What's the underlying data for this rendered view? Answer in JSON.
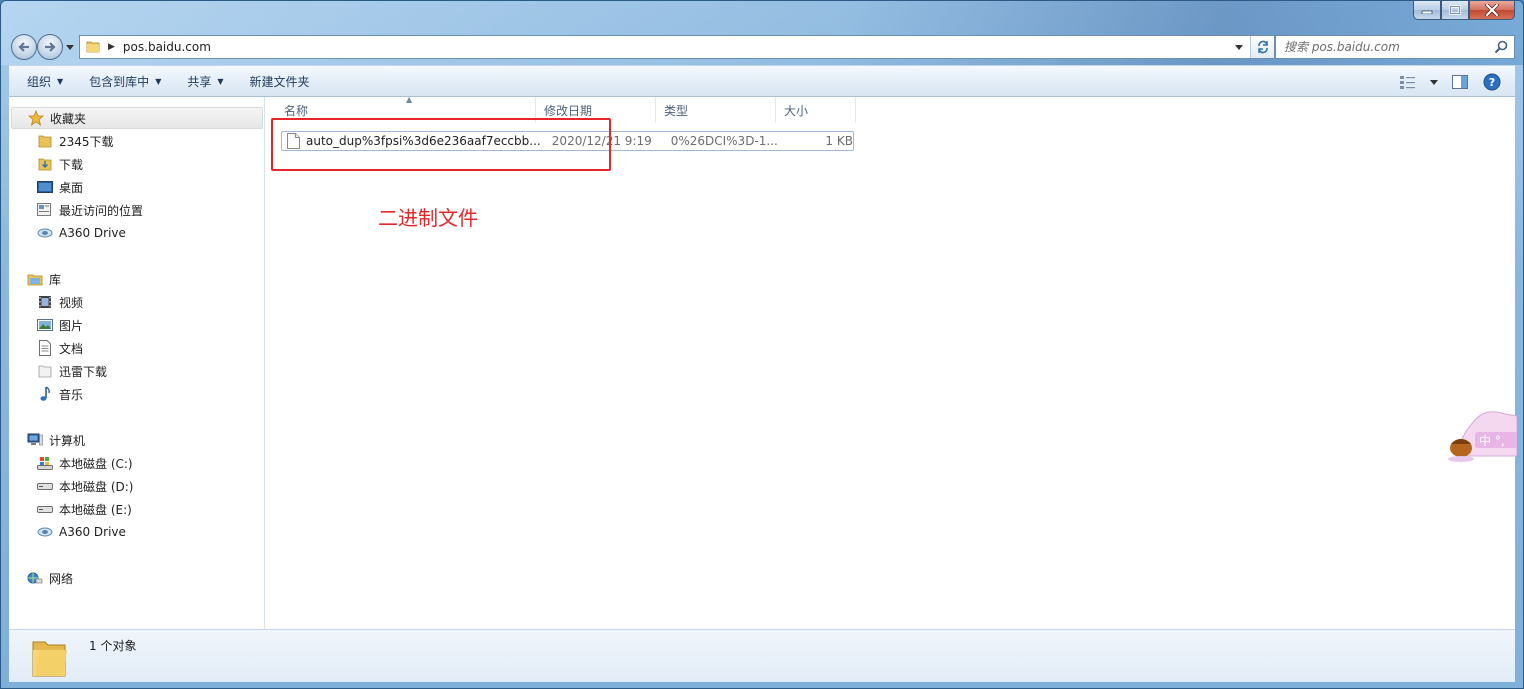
{
  "address": {
    "path": "pos.baidu.com",
    "search_placeholder": "搜索 pos.baidu.com"
  },
  "toolbar": {
    "organize": "组织",
    "include_in_library": "包含到库中",
    "share": "共享",
    "new_folder": "新建文件夹"
  },
  "navigation": {
    "favorites": {
      "header": "收藏夹",
      "items": [
        "2345下载",
        "下载",
        "桌面",
        "最近访问的位置",
        "A360 Drive"
      ]
    },
    "libraries": {
      "header": "库",
      "items": [
        "视频",
        "图片",
        "文档",
        "迅雷下载",
        "音乐"
      ]
    },
    "computer": {
      "header": "计算机",
      "items": [
        "本地磁盘 (C:)",
        "本地磁盘 (D:)",
        "本地磁盘 (E:)",
        "A360 Drive"
      ]
    },
    "network": {
      "header": "网络"
    }
  },
  "columns": {
    "name": "名称",
    "modified": "修改日期",
    "type": "类型",
    "size": "大小"
  },
  "files": [
    {
      "name": "auto_dup%3fpsi%3d6e236aaf7eccbb...",
      "modified": "2020/12/21 9:19",
      "type": "0%26DCI%3D-1...",
      "size": "1 KB"
    }
  ],
  "annotation": {
    "text": "二进制文件",
    "color": "#e8262a"
  },
  "details": {
    "count": "1 个对象"
  },
  "floating_widget": {
    "text": "中 °,"
  }
}
